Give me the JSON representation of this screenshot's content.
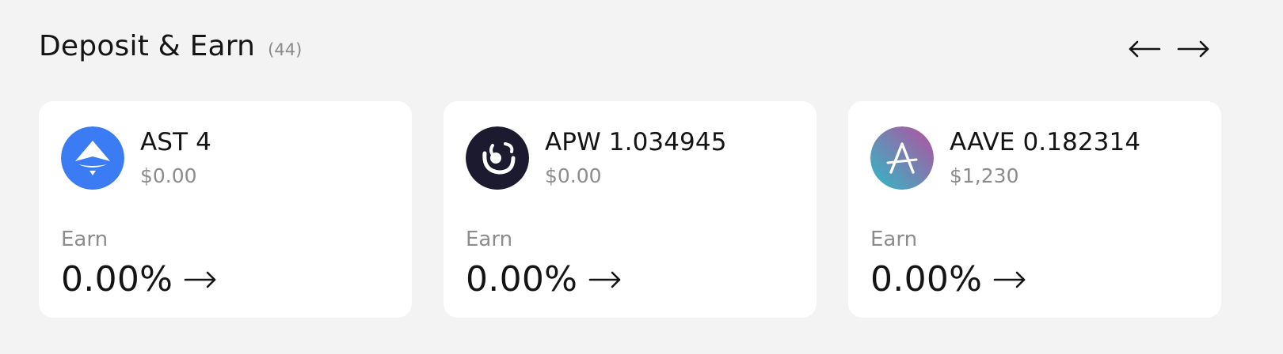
{
  "section": {
    "title": "Deposit & Earn",
    "count": "(44)"
  },
  "nav": {
    "prev_icon": "arrow-left-icon",
    "next_icon": "arrow-right-icon"
  },
  "cards": [
    {
      "token_name": "AST 4",
      "token_value": "$0.00",
      "earn_label": "Earn",
      "earn_rate": "0.00%",
      "icon": "ast-token-icon",
      "icon_color": "#3b82f6"
    },
    {
      "token_name": "APW 1.034945",
      "token_value": "$0.00",
      "earn_label": "Earn",
      "earn_rate": "0.00%",
      "icon": "apw-token-icon",
      "icon_color": "#1c1a2e"
    },
    {
      "token_name": "AAVE 0.182314",
      "token_value": "$1,230",
      "earn_label": "Earn",
      "earn_rate": "0.00%",
      "icon": "aave-token-icon",
      "icon_color": "#b6509e"
    }
  ],
  "colors": {
    "background": "#f3f3f3",
    "card": "#ffffff",
    "text_primary": "#141414",
    "text_secondary": "#8c8c8c"
  }
}
